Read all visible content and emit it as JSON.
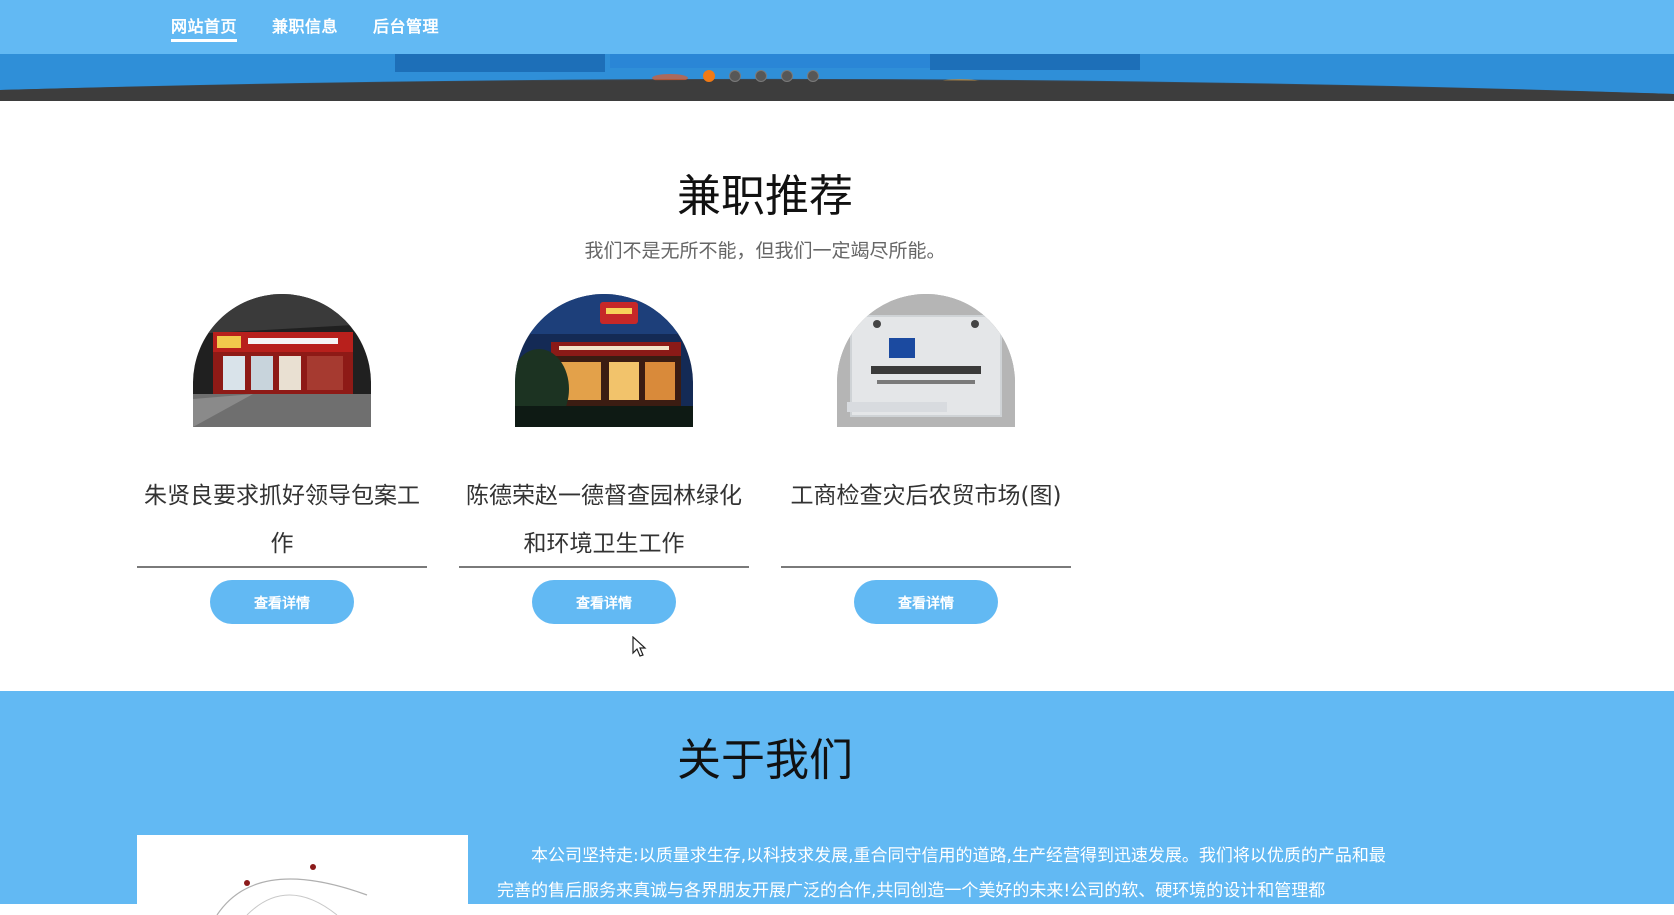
{
  "nav": {
    "items": [
      {
        "label": "网站首页",
        "active": true
      },
      {
        "label": "兼职信息",
        "active": false
      },
      {
        "label": "后台管理",
        "active": false
      }
    ]
  },
  "banner": {
    "slide_count": 5,
    "active_slide": 1
  },
  "recommend": {
    "title": "兼职推荐",
    "subtitle": "我们不是无所不能，但我们一定竭尽所能。",
    "cards": [
      {
        "title": "朱贤良要求抓好领导包案工作",
        "button": "查看详情",
        "image": "restaurant-storefront"
      },
      {
        "title": "陈德荣赵一德督查园林绿化和环境卫生工作",
        "button": "查看详情",
        "image": "cafe-storefront-night"
      },
      {
        "title": "工商检查灾后农贸市场(图)",
        "button": "查看详情",
        "image": "company-logo-sign"
      }
    ]
  },
  "about": {
    "title": "关于我们",
    "text": "本公司坚持走:以质量求生存,以科技求发展,重合同守信用的道路,生产经营得到迅速发展。我们将以优质的产品和最完善的售后服务来真诚与各界朋友开展广泛的合作,共同创造一个美好的未来!公司的软、硬环境的设计和管理都"
  },
  "colors": {
    "primary": "#62b9f3",
    "active_dot": "#f07a16",
    "title_text": "#111111"
  }
}
